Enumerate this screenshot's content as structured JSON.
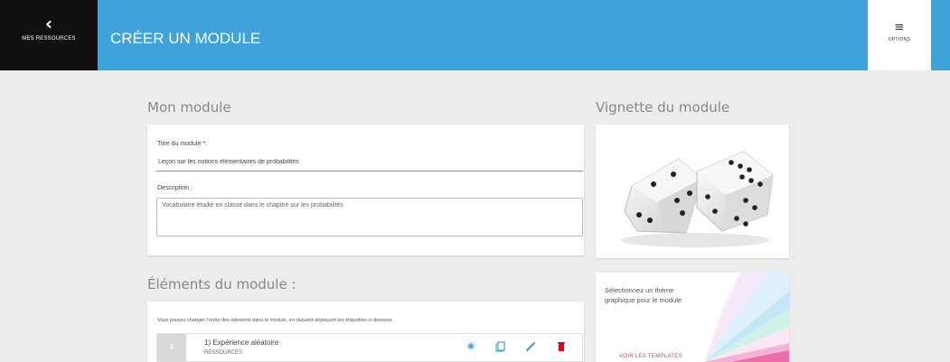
{
  "header": {
    "back_label": "MES RESSOURCES",
    "back_icon": "chevron-left-icon",
    "title": "CRÉER UN MODULE",
    "options_label": "OPTIONS",
    "options_icon": "menu-icon",
    "color": "#3ea3da"
  },
  "module": {
    "section_title": "Mon module",
    "title_label": "Titre du module *:",
    "title_value": "Leçon sur les notions élémentaires de probabilités",
    "description_label": "Description :",
    "description_value": "Vocabulaire étudié en classe dans le chapitre sur les probabilités"
  },
  "elements": {
    "section_title": "Éléments du module :",
    "hint": "Vous pouvez changer l'ordre des éléments dans le module, en cliquant-déplaçant les étiquettes ci-dessous",
    "items": [
      {
        "title": "1) Expérience aléatoire",
        "type": "RESSOURCES"
      }
    ],
    "actions": [
      {
        "icon": "target-icon",
        "color": "#3ea3da"
      },
      {
        "icon": "copy-icon",
        "color": "#3ea3da"
      },
      {
        "icon": "pencil-icon",
        "color": "#3ea3da"
      },
      {
        "icon": "trash-icon",
        "color": "#e0001b"
      }
    ]
  },
  "thumbnail": {
    "section_title": "Vignette du module",
    "image": "dice-image"
  },
  "theme": {
    "text": "Sélectionnez un thème graphique pour le module",
    "link_label": "VOIR LES TEMPLATES",
    "link_color": "#c23a7d"
  }
}
